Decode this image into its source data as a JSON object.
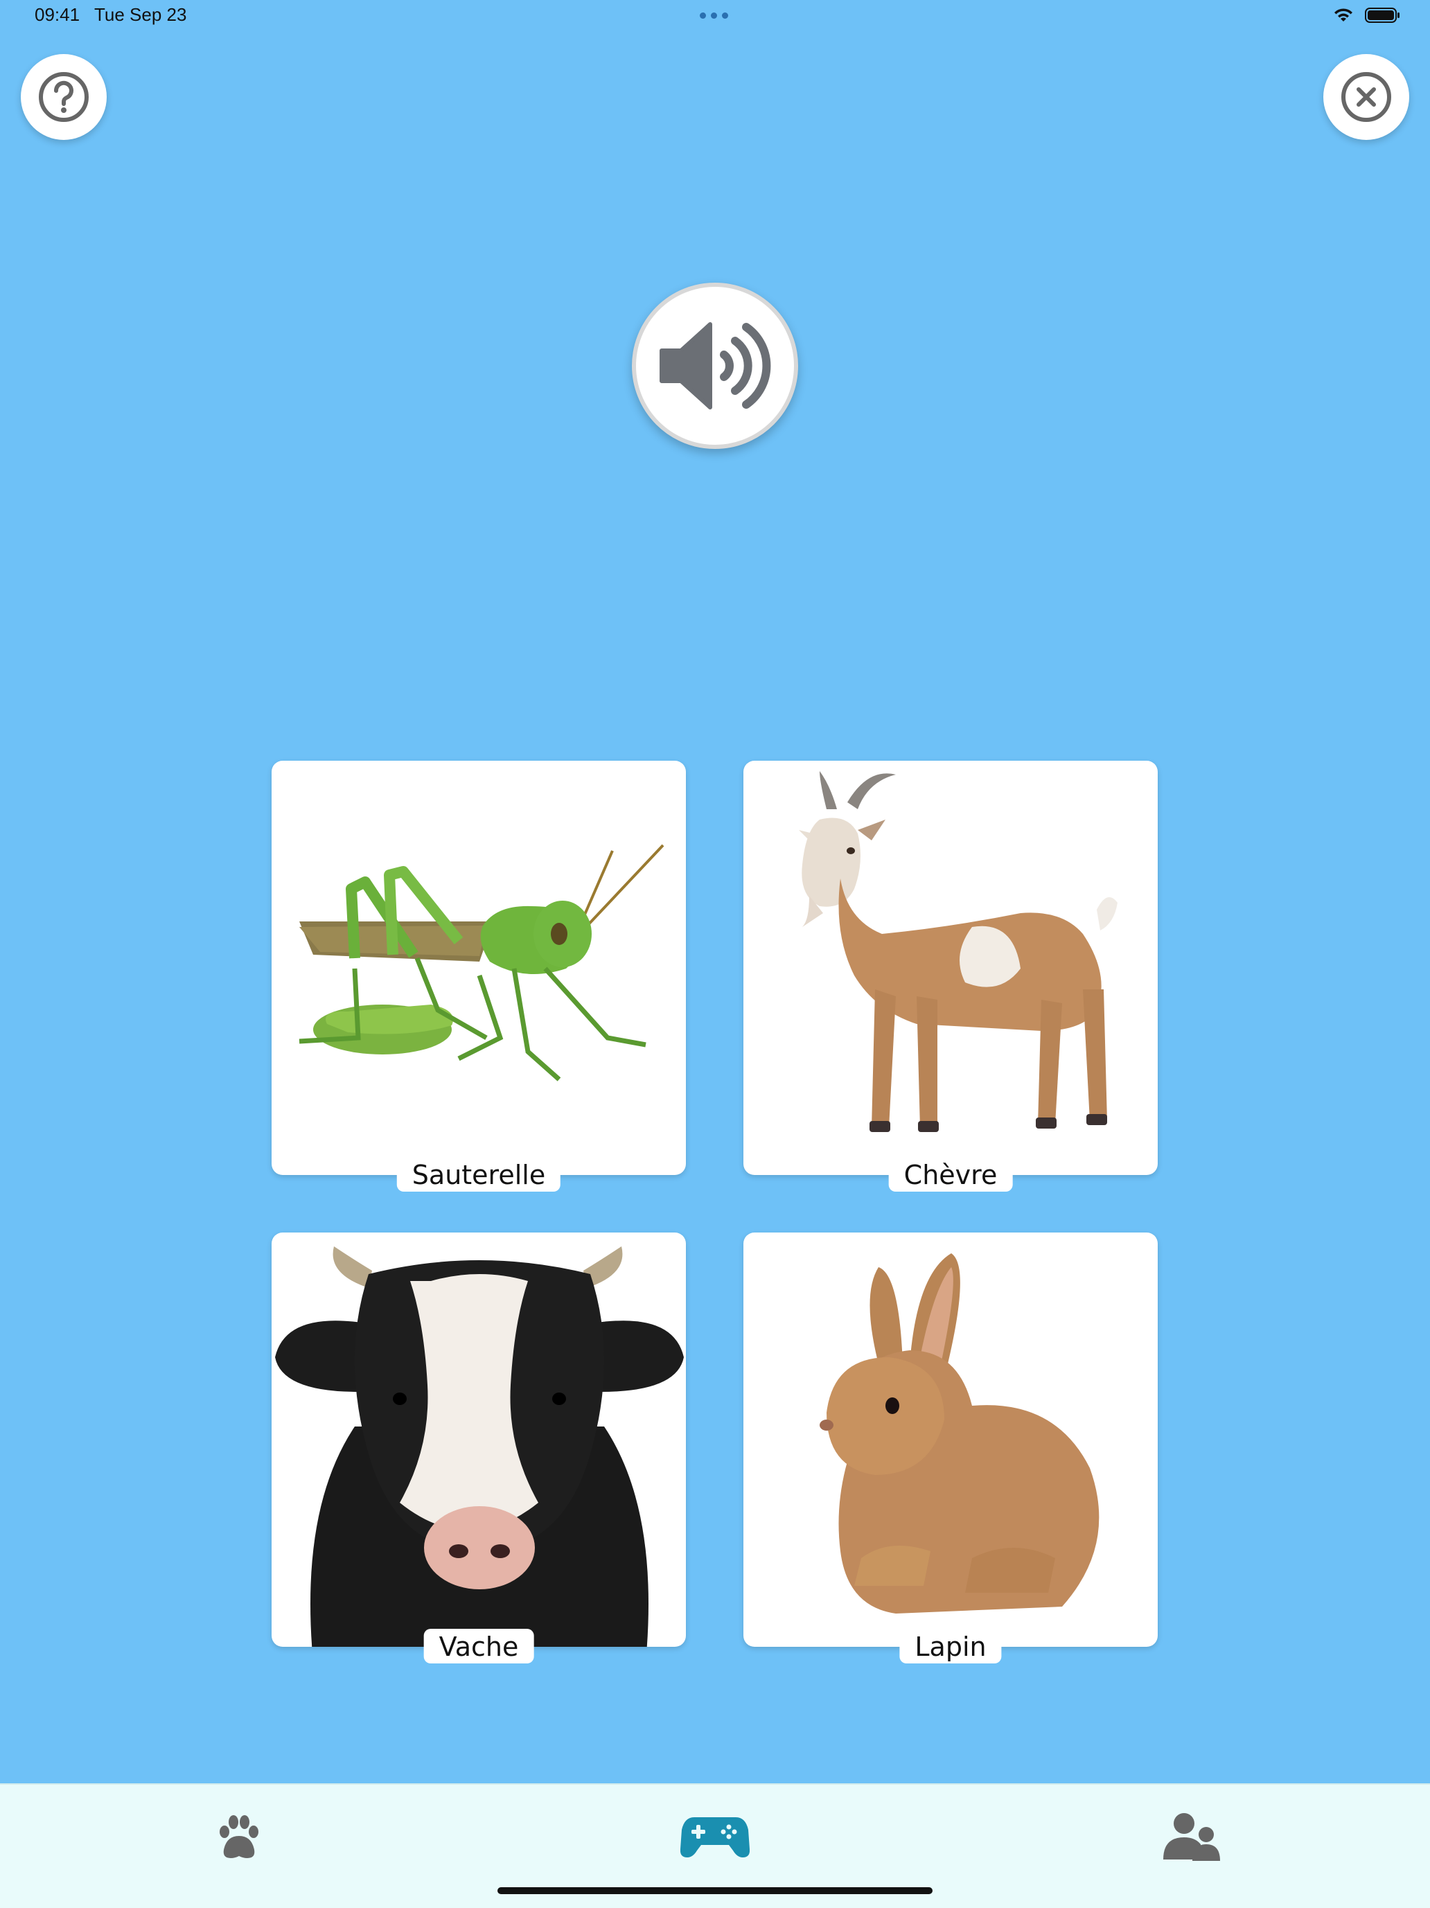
{
  "status_bar": {
    "time": "09:41",
    "date": "Tue Sep 23"
  },
  "buttons": {
    "help_icon": "question-circle-icon",
    "close_icon": "close-circle-icon",
    "sound_icon": "speaker-icon"
  },
  "cards": [
    {
      "label": "Sauterelle",
      "image": "grasshopper"
    },
    {
      "label": "Chèvre",
      "image": "goat"
    },
    {
      "label": "Vache",
      "image": "cow"
    },
    {
      "label": "Lapin",
      "image": "rabbit"
    }
  ],
  "tab_bar": {
    "tabs": [
      {
        "icon": "paw-icon",
        "selected": false
      },
      {
        "icon": "gamepad-icon",
        "selected": true
      },
      {
        "icon": "users-icon",
        "selected": false
      }
    ]
  },
  "colors": {
    "background": "#6ec1f7",
    "tab_bar": "#e9fbfb",
    "icon_gray": "#666666",
    "active_tab": "#1a8fb0"
  }
}
